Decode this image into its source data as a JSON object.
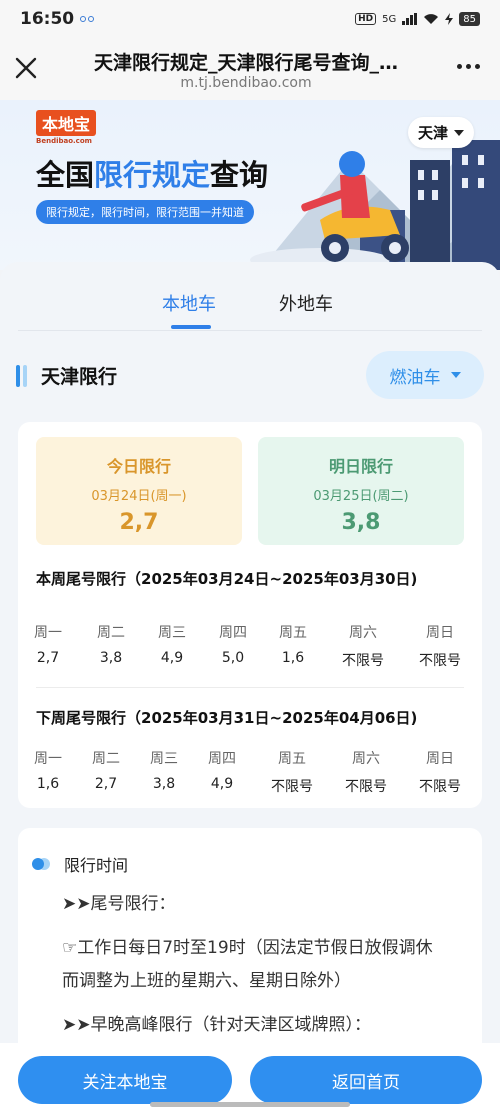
{
  "status": {
    "time": "16:50",
    "network": "5G",
    "battery": "85"
  },
  "nav": {
    "title": "天津限行规定_天津限行尾号查询_…",
    "url": "m.tj.bendibao.com"
  },
  "banner": {
    "logo_cn": "本地宝",
    "logo_en": "Bendibao.com",
    "title_part1": "全国",
    "title_highlight": "限行规定",
    "title_part2": "查询",
    "subtitle": "限行规定，限行时间，限行范围一并知道",
    "city": "天津"
  },
  "tabs": [
    {
      "label": "本地车",
      "active": true
    },
    {
      "label": "外地车",
      "active": false
    }
  ],
  "section": {
    "title": "天津限行",
    "vehicle_type": "燃油车"
  },
  "today": {
    "label": "今日限行",
    "date": "03月24日(周一)",
    "numbers": "2,7"
  },
  "tomorrow": {
    "label": "明日限行",
    "date": "03月25日(周二)",
    "numbers": "3,8"
  },
  "this_week": {
    "title": "本周尾号限行（2025年03月24日~2025年03月30日)",
    "days": [
      {
        "day": "周一",
        "nums": "2,7"
      },
      {
        "day": "周二",
        "nums": "3,8"
      },
      {
        "day": "周三",
        "nums": "4,9"
      },
      {
        "day": "周四",
        "nums": "5,0"
      },
      {
        "day": "周五",
        "nums": "1,6"
      },
      {
        "day": "周六",
        "nums": "不限号"
      },
      {
        "day": "周日",
        "nums": "不限号"
      }
    ]
  },
  "next_week": {
    "title": "下周尾号限行（2025年03月31日~2025年04月06日)",
    "days": [
      {
        "day": "周一",
        "nums": "1,6"
      },
      {
        "day": "周二",
        "nums": "2,7"
      },
      {
        "day": "周三",
        "nums": "3,8"
      },
      {
        "day": "周四",
        "nums": "4,9"
      },
      {
        "day": "周五",
        "nums": "不限号"
      },
      {
        "day": "周六",
        "nums": "不限号"
      },
      {
        "day": "周日",
        "nums": "不限号"
      }
    ]
  },
  "restriction_time": {
    "title": "限行时间",
    "line1": "➤➤尾号限行：",
    "line2": "☞工作日每日7时至19时（因法定节假日放假调休",
    "line3": "而调整为上班的星期六、星期日除外）",
    "line4": "➤➤早晚高峰限行（针对天津区域牌照）："
  },
  "bottom": {
    "follow_label": "关注本地宝",
    "home_label": "返回首页"
  },
  "colors": {
    "accent": "#2f7fe8",
    "today": "#d9962b",
    "tomorrow": "#4c9a73"
  }
}
